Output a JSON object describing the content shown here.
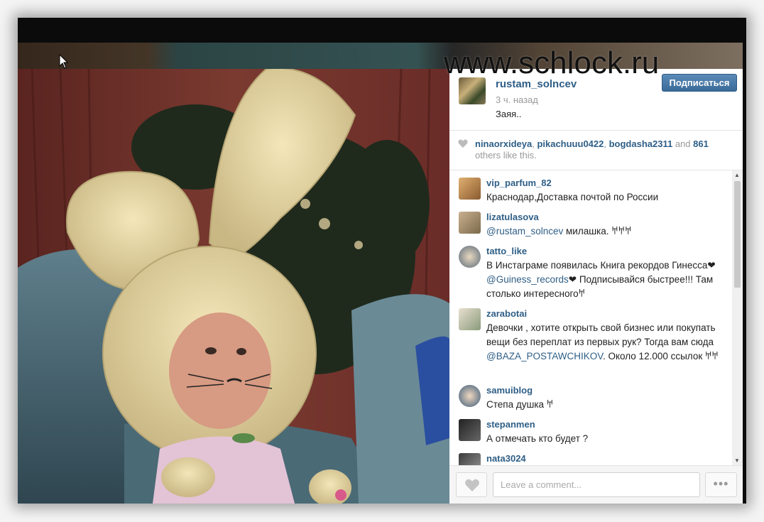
{
  "watermark": "www.schlock.ru",
  "post": {
    "username": "rustam_solncev",
    "time": "3 ч. назад",
    "caption": "Заяя..",
    "follow_label": "Подписаться"
  },
  "likes": {
    "users": [
      "ninaorxideya",
      "pikachuuu0422",
      "bogdasha2311"
    ],
    "sep1": ", ",
    "sep2": ", ",
    "and": " and ",
    "count": "861",
    "suffix": " others like this."
  },
  "comments": [
    {
      "username": "vip_parfum_82",
      "text": "Краснодар,Доставка почтой по России"
    },
    {
      "username": "lizatulasova",
      "mention": "@rustam_solncev",
      "text": " милашка. 𐀀𐀀𐀀"
    },
    {
      "username": "tatto_like",
      "text_before": "В Инстаграме появилась Книга рекордов Гинесса❤",
      "mention": "@Guiness_records",
      "text_after": "❤ Подписывайся быстрее!!! Там столько интересного𐀀"
    },
    {
      "username": "zarabotai",
      "text_before": "Девочки , хотите открыть свой бизнес или покупать вещи без переплат из первых рук? Тогда вам сюда ",
      "mention": "@BAZA_POSTAWCHIKOV",
      "text_after": ". Около 12.000 ссылок 𐀀𐀀"
    },
    {
      "username": "samuiblog",
      "text": "Степа душка 𐀀"
    },
    {
      "username": "stepanmen",
      "text": "А отмечать кто будет ?"
    },
    {
      "username": "nata3024",
      "text": ""
    }
  ],
  "comment_input": {
    "placeholder": "Leave a comment..."
  },
  "more_label": "•••",
  "colors": {
    "link": "#2e5e86",
    "follow": "#3a6a98"
  }
}
